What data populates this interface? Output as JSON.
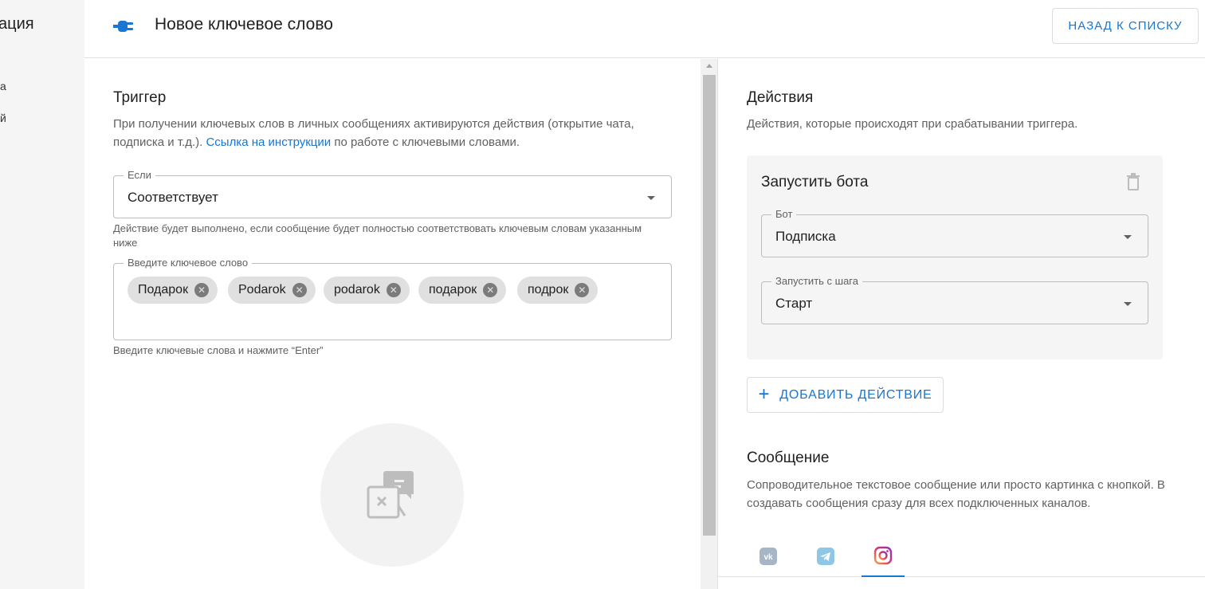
{
  "sidebar": {
    "title_fragment": "ация",
    "items": [
      {
        "label": "а"
      },
      {
        "label": "й"
      }
    ]
  },
  "header": {
    "title": "Новое ключевое слово",
    "plug_icon": "plug-icon",
    "back_button": "НАЗАД К СПИСКУ"
  },
  "trigger": {
    "title": "Триггер",
    "desc_before": "При получении ключевых слов в личных сообщениях активируются действия (открытие чата, подписка и т.д.). ",
    "desc_link": "Ссылка на инструкции",
    "desc_after": " по работе с ключевыми словами.",
    "condition": {
      "label": "Если",
      "value": "Соответствует",
      "helper": "Действие будет выполнено, если сообщение будет полностью соответствовать ключевым словам указанным ниже"
    },
    "keywords": {
      "label": "Введите ключевое слово",
      "chips": [
        "Подарок",
        "Podarok",
        "podarok",
        "подарок",
        "подрок"
      ],
      "helper": "Введите ключевые слова и нажмите “Enter”"
    }
  },
  "actions": {
    "title": "Действия",
    "desc": "Действия, которые происходят при срабатывании триггера.",
    "card": {
      "title": "Запустить бота",
      "bot_label": "Бот",
      "bot_value": "Подписка",
      "step_label": "Запустить с шага",
      "step_value": "Старт"
    },
    "add_button": "ДОБАВИТЬ ДЕЙСТВИЕ"
  },
  "message": {
    "title": "Сообщение",
    "desc": "Сопроводительное текстовое сообщение или просто картинка с кнопкой. В создавать сообщения сразу для всех подключенных каналов.",
    "tabs": [
      {
        "icon": "vk-icon",
        "active": false
      },
      {
        "icon": "telegram-icon",
        "active": false
      },
      {
        "icon": "instagram-icon",
        "active": true
      }
    ]
  },
  "colors": {
    "accent": "#1976d2",
    "chip_bg": "#e0e0e0",
    "card_bg": "#f5f5f5"
  }
}
